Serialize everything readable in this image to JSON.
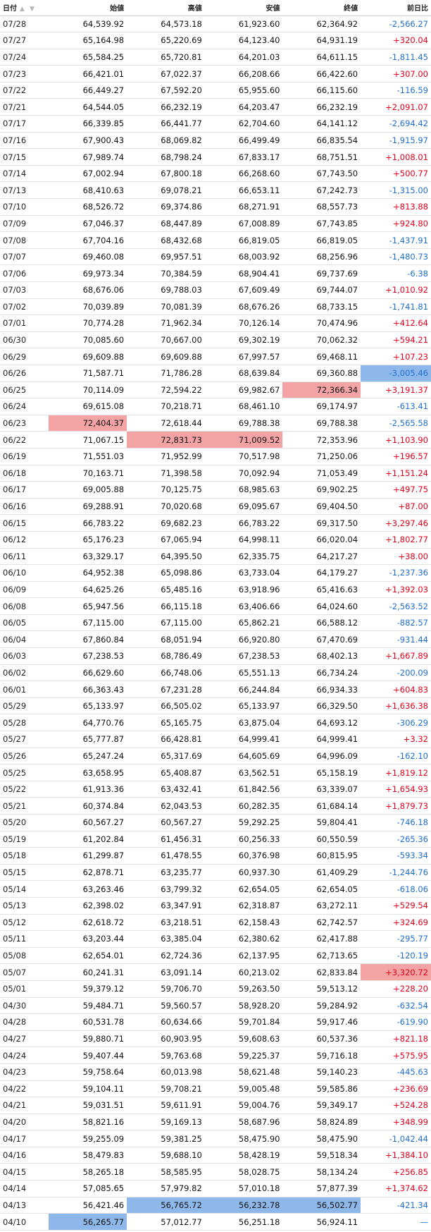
{
  "header": {
    "date": "日付",
    "open": "始値",
    "high": "高値",
    "low": "安値",
    "close": "終値",
    "change": "前日比",
    "sort_icons": "▲ ▼"
  },
  "colors": {
    "positive": "#e3001b",
    "negative": "#1f6fd1",
    "highlight_high": "#f3a3a3",
    "highlight_low": "#8fb8ea"
  },
  "rows": [
    {
      "date": "07/28",
      "open": "64,539.92",
      "high": "64,573.18",
      "low": "61,923.60",
      "close": "62,364.92",
      "change": "-2,566.27",
      "dir": "neg",
      "hl": {}
    },
    {
      "date": "07/27",
      "open": "65,164.98",
      "high": "65,220.69",
      "low": "64,123.40",
      "close": "64,931.19",
      "change": "+320.04",
      "dir": "pos",
      "hl": {}
    },
    {
      "date": "07/24",
      "open": "65,584.25",
      "high": "65,720.81",
      "low": "64,201.03",
      "close": "64,611.15",
      "change": "-1,811.45",
      "dir": "neg",
      "hl": {}
    },
    {
      "date": "07/23",
      "open": "66,421.01",
      "high": "67,022.37",
      "low": "66,208.66",
      "close": "66,422.60",
      "change": "+307.00",
      "dir": "pos",
      "hl": {}
    },
    {
      "date": "07/22",
      "open": "66,449.27",
      "high": "67,592.20",
      "low": "65,955.60",
      "close": "66,115.60",
      "change": "-116.59",
      "dir": "neg",
      "hl": {}
    },
    {
      "date": "07/21",
      "open": "64,544.05",
      "high": "66,232.19",
      "low": "64,203.47",
      "close": "66,232.19",
      "change": "+2,091.07",
      "dir": "pos",
      "hl": {}
    },
    {
      "date": "07/17",
      "open": "66,339.85",
      "high": "66,441.77",
      "low": "62,704.60",
      "close": "64,141.12",
      "change": "-2,694.42",
      "dir": "neg",
      "hl": {}
    },
    {
      "date": "07/16",
      "open": "67,900.43",
      "high": "68,069.82",
      "low": "66,499.49",
      "close": "66,835.54",
      "change": "-1,915.97",
      "dir": "neg",
      "hl": {}
    },
    {
      "date": "07/15",
      "open": "67,989.74",
      "high": "68,798.24",
      "low": "67,833.17",
      "close": "68,751.51",
      "change": "+1,008.01",
      "dir": "pos",
      "hl": {}
    },
    {
      "date": "07/14",
      "open": "67,002.94",
      "high": "67,800.18",
      "low": "66,268.60",
      "close": "67,743.50",
      "change": "+500.77",
      "dir": "pos",
      "hl": {}
    },
    {
      "date": "07/13",
      "open": "68,410.63",
      "high": "69,078.21",
      "low": "66,653.11",
      "close": "67,242.73",
      "change": "-1,315.00",
      "dir": "neg",
      "hl": {}
    },
    {
      "date": "07/10",
      "open": "68,526.72",
      "high": "69,374.86",
      "low": "68,271.91",
      "close": "68,557.73",
      "change": "+813.88",
      "dir": "pos",
      "hl": {}
    },
    {
      "date": "07/09",
      "open": "67,046.37",
      "high": "68,447.89",
      "low": "67,008.89",
      "close": "67,743.85",
      "change": "+924.80",
      "dir": "pos",
      "hl": {}
    },
    {
      "date": "07/08",
      "open": "67,704.16",
      "high": "68,432.68",
      "low": "66,819.05",
      "close": "66,819.05",
      "change": "-1,437.91",
      "dir": "neg",
      "hl": {}
    },
    {
      "date": "07/07",
      "open": "69,460.08",
      "high": "69,957.51",
      "low": "68,003.92",
      "close": "68,256.96",
      "change": "-1,480.73",
      "dir": "neg",
      "hl": {}
    },
    {
      "date": "07/06",
      "open": "69,973.34",
      "high": "70,384.59",
      "low": "68,904.41",
      "close": "69,737.69",
      "change": "-6.38",
      "dir": "neg",
      "hl": {}
    },
    {
      "date": "07/03",
      "open": "68,676.06",
      "high": "69,788.03",
      "low": "67,609.49",
      "close": "69,744.07",
      "change": "+1,010.92",
      "dir": "pos",
      "hl": {}
    },
    {
      "date": "07/02",
      "open": "70,039.89",
      "high": "70,081.39",
      "low": "68,676.26",
      "close": "68,733.15",
      "change": "-1,741.81",
      "dir": "neg",
      "hl": {}
    },
    {
      "date": "07/01",
      "open": "70,774.28",
      "high": "71,962.34",
      "low": "70,126.14",
      "close": "70,474.96",
      "change": "+412.64",
      "dir": "pos",
      "hl": {}
    },
    {
      "date": "06/30",
      "open": "70,085.60",
      "high": "70,667.00",
      "low": "69,302.19",
      "close": "70,062.32",
      "change": "+594.21",
      "dir": "pos",
      "hl": {}
    },
    {
      "date": "06/29",
      "open": "69,609.88",
      "high": "69,609.88",
      "low": "67,997.57",
      "close": "69,468.11",
      "change": "+107.23",
      "dir": "pos",
      "hl": {}
    },
    {
      "date": "06/26",
      "open": "71,587.71",
      "high": "71,786.28",
      "low": "68,639.84",
      "close": "69,360.88",
      "change": "-3,005.46",
      "dir": "neg",
      "hl": {
        "change": "blue"
      }
    },
    {
      "date": "06/25",
      "open": "70,114.09",
      "high": "72,594.22",
      "low": "69,982.67",
      "close": "72,366.34",
      "change": "+3,191.37",
      "dir": "pos",
      "hl": {
        "close": "red"
      }
    },
    {
      "date": "06/24",
      "open": "69,615.08",
      "high": "70,218.71",
      "low": "68,461.10",
      "close": "69,174.97",
      "change": "-613.41",
      "dir": "neg",
      "hl": {}
    },
    {
      "date": "06/23",
      "open": "72,404.37",
      "high": "72,618.44",
      "low": "69,788.38",
      "close": "69,788.38",
      "change": "-2,565.58",
      "dir": "neg",
      "hl": {
        "open": "red"
      }
    },
    {
      "date": "06/22",
      "open": "71,067.15",
      "high": "72,831.73",
      "low": "71,009.52",
      "close": "72,353.96",
      "change": "+1,103.90",
      "dir": "pos",
      "hl": {
        "high": "red",
        "low": "red"
      }
    },
    {
      "date": "06/19",
      "open": "71,551.03",
      "high": "71,952.99",
      "low": "70,517.98",
      "close": "71,250.06",
      "change": "+196.57",
      "dir": "pos",
      "hl": {}
    },
    {
      "date": "06/18",
      "open": "70,163.71",
      "high": "71,398.58",
      "low": "70,092.94",
      "close": "71,053.49",
      "change": "+1,151.24",
      "dir": "pos",
      "hl": {}
    },
    {
      "date": "06/17",
      "open": "69,005.88",
      "high": "70,125.75",
      "low": "68,985.63",
      "close": "69,902.25",
      "change": "+497.75",
      "dir": "pos",
      "hl": {}
    },
    {
      "date": "06/16",
      "open": "69,288.91",
      "high": "70,020.68",
      "low": "69,095.67",
      "close": "69,404.50",
      "change": "+87.00",
      "dir": "pos",
      "hl": {}
    },
    {
      "date": "06/15",
      "open": "66,783.22",
      "high": "69,682.23",
      "low": "66,783.22",
      "close": "69,317.50",
      "change": "+3,297.46",
      "dir": "pos",
      "hl": {}
    },
    {
      "date": "06/12",
      "open": "65,176.23",
      "high": "67,065.94",
      "low": "64,998.11",
      "close": "66,020.04",
      "change": "+1,802.77",
      "dir": "pos",
      "hl": {}
    },
    {
      "date": "06/11",
      "open": "63,329.17",
      "high": "64,395.50",
      "low": "62,335.75",
      "close": "64,217.27",
      "change": "+38.00",
      "dir": "pos",
      "hl": {}
    },
    {
      "date": "06/10",
      "open": "64,952.38",
      "high": "65,098.86",
      "low": "63,733.04",
      "close": "64,179.27",
      "change": "-1,237.36",
      "dir": "neg",
      "hl": {}
    },
    {
      "date": "06/09",
      "open": "64,625.26",
      "high": "65,485.16",
      "low": "63,918.96",
      "close": "65,416.63",
      "change": "+1,392.03",
      "dir": "pos",
      "hl": {}
    },
    {
      "date": "06/08",
      "open": "65,947.56",
      "high": "66,115.18",
      "low": "63,406.66",
      "close": "64,024.60",
      "change": "-2,563.52",
      "dir": "neg",
      "hl": {}
    },
    {
      "date": "06/05",
      "open": "67,115.00",
      "high": "67,115.00",
      "low": "65,862.21",
      "close": "66,588.12",
      "change": "-882.57",
      "dir": "neg",
      "hl": {}
    },
    {
      "date": "06/04",
      "open": "67,860.84",
      "high": "68,051.94",
      "low": "66,920.80",
      "close": "67,470.69",
      "change": "-931.44",
      "dir": "neg",
      "hl": {}
    },
    {
      "date": "06/03",
      "open": "67,238.53",
      "high": "68,786.49",
      "low": "67,238.53",
      "close": "68,402.13",
      "change": "+1,667.89",
      "dir": "pos",
      "hl": {}
    },
    {
      "date": "06/02",
      "open": "66,629.60",
      "high": "66,748.06",
      "low": "65,551.13",
      "close": "66,734.24",
      "change": "-200.09",
      "dir": "neg",
      "hl": {}
    },
    {
      "date": "06/01",
      "open": "66,363.43",
      "high": "67,231.28",
      "low": "66,244.84",
      "close": "66,934.33",
      "change": "+604.83",
      "dir": "pos",
      "hl": {}
    },
    {
      "date": "05/29",
      "open": "65,133.97",
      "high": "66,505.02",
      "low": "65,133.97",
      "close": "66,329.50",
      "change": "+1,636.38",
      "dir": "pos",
      "hl": {}
    },
    {
      "date": "05/28",
      "open": "64,770.76",
      "high": "65,165.75",
      "low": "63,875.04",
      "close": "64,693.12",
      "change": "-306.29",
      "dir": "neg",
      "hl": {}
    },
    {
      "date": "05/27",
      "open": "65,777.87",
      "high": "66,428.81",
      "low": "64,999.41",
      "close": "64,999.41",
      "change": "+3.32",
      "dir": "pos",
      "hl": {}
    },
    {
      "date": "05/26",
      "open": "65,247.24",
      "high": "65,317.69",
      "low": "64,605.69",
      "close": "64,996.09",
      "change": "-162.10",
      "dir": "neg",
      "hl": {}
    },
    {
      "date": "05/25",
      "open": "63,658.95",
      "high": "65,408.87",
      "low": "63,562.51",
      "close": "65,158.19",
      "change": "+1,819.12",
      "dir": "pos",
      "hl": {}
    },
    {
      "date": "05/22",
      "open": "61,913.36",
      "high": "63,432.41",
      "low": "61,842.56",
      "close": "63,339.07",
      "change": "+1,654.93",
      "dir": "pos",
      "hl": {}
    },
    {
      "date": "05/21",
      "open": "60,374.84",
      "high": "62,043.53",
      "low": "60,282.35",
      "close": "61,684.14",
      "change": "+1,879.73",
      "dir": "pos",
      "hl": {}
    },
    {
      "date": "05/20",
      "open": "60,567.27",
      "high": "60,567.27",
      "low": "59,292.25",
      "close": "59,804.41",
      "change": "-746.18",
      "dir": "neg",
      "hl": {}
    },
    {
      "date": "05/19",
      "open": "61,202.84",
      "high": "61,456.31",
      "low": "60,256.33",
      "close": "60,550.59",
      "change": "-265.36",
      "dir": "neg",
      "hl": {}
    },
    {
      "date": "05/18",
      "open": "61,299.87",
      "high": "61,478.55",
      "low": "60,376.98",
      "close": "60,815.95",
      "change": "-593.34",
      "dir": "neg",
      "hl": {}
    },
    {
      "date": "05/15",
      "open": "62,878.71",
      "high": "63,235.77",
      "low": "60,937.30",
      "close": "61,409.29",
      "change": "-1,244.76",
      "dir": "neg",
      "hl": {}
    },
    {
      "date": "05/14",
      "open": "63,263.46",
      "high": "63,799.32",
      "low": "62,654.05",
      "close": "62,654.05",
      "change": "-618.06",
      "dir": "neg",
      "hl": {}
    },
    {
      "date": "05/13",
      "open": "62,398.02",
      "high": "63,347.91",
      "low": "62,318.87",
      "close": "63,272.11",
      "change": "+529.54",
      "dir": "pos",
      "hl": {}
    },
    {
      "date": "05/12",
      "open": "62,618.72",
      "high": "63,218.51",
      "low": "62,158.43",
      "close": "62,742.57",
      "change": "+324.69",
      "dir": "pos",
      "hl": {}
    },
    {
      "date": "05/11",
      "open": "63,203.44",
      "high": "63,385.04",
      "low": "62,380.62",
      "close": "62,417.88",
      "change": "-295.77",
      "dir": "neg",
      "hl": {}
    },
    {
      "date": "05/08",
      "open": "62,654.01",
      "high": "62,724.36",
      "low": "62,137.95",
      "close": "62,713.65",
      "change": "-120.19",
      "dir": "neg",
      "hl": {}
    },
    {
      "date": "05/07",
      "open": "60,241.31",
      "high": "63,091.14",
      "low": "60,213.02",
      "close": "62,833.84",
      "change": "+3,320.72",
      "dir": "pos",
      "hl": {
        "change": "red"
      }
    },
    {
      "date": "05/01",
      "open": "59,379.12",
      "high": "59,706.70",
      "low": "59,263.50",
      "close": "59,513.12",
      "change": "+228.20",
      "dir": "pos",
      "hl": {}
    },
    {
      "date": "04/30",
      "open": "59,484.71",
      "high": "59,560.57",
      "low": "58,928.20",
      "close": "59,284.92",
      "change": "-632.54",
      "dir": "neg",
      "hl": {}
    },
    {
      "date": "04/28",
      "open": "60,531.78",
      "high": "60,634.66",
      "low": "59,701.84",
      "close": "59,917.46",
      "change": "-619.90",
      "dir": "neg",
      "hl": {}
    },
    {
      "date": "04/27",
      "open": "59,880.71",
      "high": "60,903.95",
      "low": "59,608.63",
      "close": "60,537.36",
      "change": "+821.18",
      "dir": "pos",
      "hl": {}
    },
    {
      "date": "04/24",
      "open": "59,407.44",
      "high": "59,763.68",
      "low": "59,225.37",
      "close": "59,716.18",
      "change": "+575.95",
      "dir": "pos",
      "hl": {}
    },
    {
      "date": "04/23",
      "open": "59,758.64",
      "high": "60,013.98",
      "low": "58,621.48",
      "close": "59,140.23",
      "change": "-445.63",
      "dir": "neg",
      "hl": {}
    },
    {
      "date": "04/22",
      "open": "59,104.11",
      "high": "59,708.21",
      "low": "59,005.48",
      "close": "59,585.86",
      "change": "+236.69",
      "dir": "pos",
      "hl": {}
    },
    {
      "date": "04/21",
      "open": "59,031.51",
      "high": "59,611.91",
      "low": "59,004.76",
      "close": "59,349.17",
      "change": "+524.28",
      "dir": "pos",
      "hl": {}
    },
    {
      "date": "04/20",
      "open": "58,821.16",
      "high": "59,169.13",
      "low": "58,687.96",
      "close": "58,824.89",
      "change": "+348.99",
      "dir": "pos",
      "hl": {}
    },
    {
      "date": "04/17",
      "open": "59,255.09",
      "high": "59,381.25",
      "low": "58,475.90",
      "close": "58,475.90",
      "change": "-1,042.44",
      "dir": "neg",
      "hl": {}
    },
    {
      "date": "04/16",
      "open": "58,479.83",
      "high": "59,688.10",
      "low": "58,428.19",
      "close": "59,518.34",
      "change": "+1,384.10",
      "dir": "pos",
      "hl": {}
    },
    {
      "date": "04/15",
      "open": "58,265.18",
      "high": "58,585.95",
      "low": "58,028.75",
      "close": "58,134.24",
      "change": "+256.85",
      "dir": "pos",
      "hl": {}
    },
    {
      "date": "04/14",
      "open": "57,085.65",
      "high": "57,979.82",
      "low": "57,010.18",
      "close": "57,877.39",
      "change": "+1,374.62",
      "dir": "pos",
      "hl": {}
    },
    {
      "date": "04/13",
      "open": "56,421.46",
      "high": "56,765.72",
      "low": "56,232.78",
      "close": "56,502.77",
      "change": "-421.34",
      "dir": "neg",
      "hl": {
        "high": "blue",
        "low": "blue",
        "close": "blue"
      }
    },
    {
      "date": "04/10",
      "open": "56,265.77",
      "high": "57,012.77",
      "low": "56,251.18",
      "close": "56,924.11",
      "change": "—",
      "dir": "flat",
      "hl": {
        "open": "blue"
      }
    }
  ]
}
